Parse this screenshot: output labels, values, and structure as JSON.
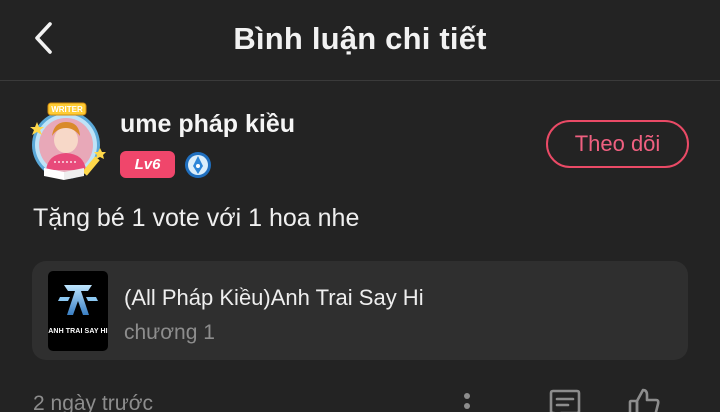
{
  "header": {
    "title": "Bình luận chi tiết"
  },
  "user": {
    "name": "ume pháp kiều",
    "level": "Lv6",
    "avatar_badge": "WRITER"
  },
  "follow_label": "Theo dõi",
  "comment": {
    "text": "Tặng bé 1 vote với 1 hoa nhe"
  },
  "book": {
    "title": "(All Pháp Kiều)Anh Trai Say Hi",
    "chapter": "chương 1",
    "cover_text": "ANH TRAI SAY HI"
  },
  "footer": {
    "time": "2 ngày trước"
  },
  "colors": {
    "background": "#232323",
    "card": "#2f2f2f",
    "accent": "#ea4a66",
    "level_badge": "#f0466b",
    "muted_text": "#8d8d8d"
  },
  "icons": [
    "back-arrow-icon",
    "pen-badge-icon",
    "more-vertical-icon",
    "comment-icon",
    "like-icon"
  ]
}
